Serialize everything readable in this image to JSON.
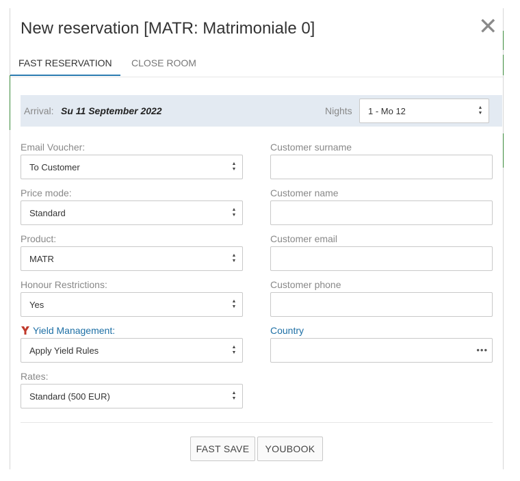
{
  "dialog": {
    "title": "New reservation [MATR: Matrimoniale 0]"
  },
  "icons": {
    "close": "close-icon",
    "yield": "yield-y-icon",
    "select_arrows": "sort-arrows-icon",
    "more": "ellipsis-icon"
  },
  "colors": {
    "tab_active_underline": "#2a7ab0",
    "arrival_bar_bg": "#e3eaf2",
    "link_blue": "#1d6fa5",
    "yield_icon_red": "#c0392b"
  },
  "tabs": [
    {
      "label": "FAST RESERVATION",
      "active": true
    },
    {
      "label": "CLOSE ROOM",
      "active": false
    }
  ],
  "arrival": {
    "label": "Arrival:",
    "date": "Su 11 September 2022",
    "nights_label": "Nights",
    "nights_value": "1 - Mo 12"
  },
  "left_fields": {
    "email_voucher": {
      "label": "Email Voucher:",
      "value": "To Customer"
    },
    "price_mode": {
      "label": "Price mode:",
      "value": "Standard"
    },
    "product": {
      "label": "Product:",
      "value": "MATR"
    },
    "honour_restrictions": {
      "label": "Honour Restrictions:",
      "value": "Yes"
    },
    "yield_management": {
      "label": "Yield Management:",
      "value": "Apply Yield Rules"
    },
    "rates": {
      "label": "Rates:",
      "value": "Standard (500 EUR)"
    }
  },
  "right_fields": {
    "surname": {
      "label": "Customer surname",
      "value": ""
    },
    "name": {
      "label": "Customer name",
      "value": ""
    },
    "email": {
      "label": "Customer email",
      "value": ""
    },
    "phone": {
      "label": "Customer phone",
      "value": ""
    },
    "country": {
      "label": "Country",
      "value": ""
    }
  },
  "buttons": {
    "fast_save": "FAST SAVE",
    "youbook": "YOUBOOK"
  }
}
